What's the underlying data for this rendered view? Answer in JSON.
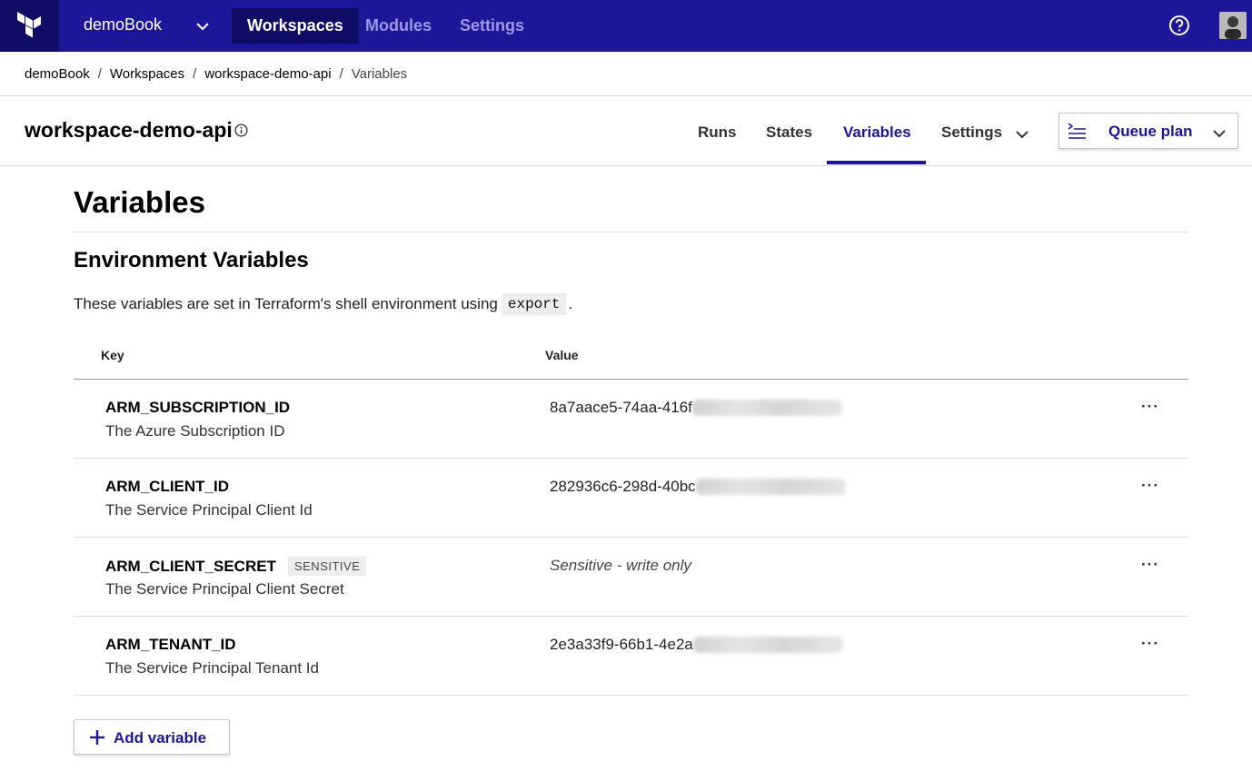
{
  "nav": {
    "org": "demoBook",
    "tabs": [
      "Workspaces",
      "Modules",
      "Settings"
    ],
    "active_tab": "Workspaces",
    "icons": {
      "logo": "terraform-logo-icon",
      "help": "help-circle-icon"
    },
    "colors": {
      "bar": "#1c1699",
      "active": "#0f0c66"
    }
  },
  "breadcrumb": [
    "demoBook",
    "Workspaces",
    "workspace-demo-api",
    "Variables"
  ],
  "workspace": {
    "title": "workspace-demo-api",
    "tabs": [
      "Runs",
      "States",
      "Variables",
      "Settings"
    ],
    "active_tab": "Variables",
    "queue_plan_label": "Queue plan"
  },
  "page": {
    "title": "Variables",
    "section_title": "Environment Variables",
    "description_prefix": "These variables are set in Terraform's shell environment using",
    "description_code": "export",
    "description_suffix": ".",
    "columns": {
      "key": "Key",
      "value": "Value"
    },
    "variables": [
      {
        "key": "ARM_SUBSCRIPTION_ID",
        "description": "The Azure Subscription ID",
        "value": "8a7aace5-74aa-416f",
        "value_blurred": true,
        "sensitive": false
      },
      {
        "key": "ARM_CLIENT_ID",
        "description": "The Service Principal Client Id",
        "value": "282936c6-298d-40bc",
        "value_blurred": true,
        "sensitive": false
      },
      {
        "key": "ARM_CLIENT_SECRET",
        "description": "The Service Principal Client Secret",
        "value": "Sensitive - write only",
        "value_blurred": false,
        "sensitive": true,
        "badge": "SENSITIVE"
      },
      {
        "key": "ARM_TENANT_ID",
        "description": "The Service Principal Tenant Id",
        "value": "2e3a33f9-66b1-4e2a",
        "value_blurred": true,
        "sensitive": false
      }
    ],
    "row_menu": "···",
    "add_variable_label": "Add variable"
  }
}
